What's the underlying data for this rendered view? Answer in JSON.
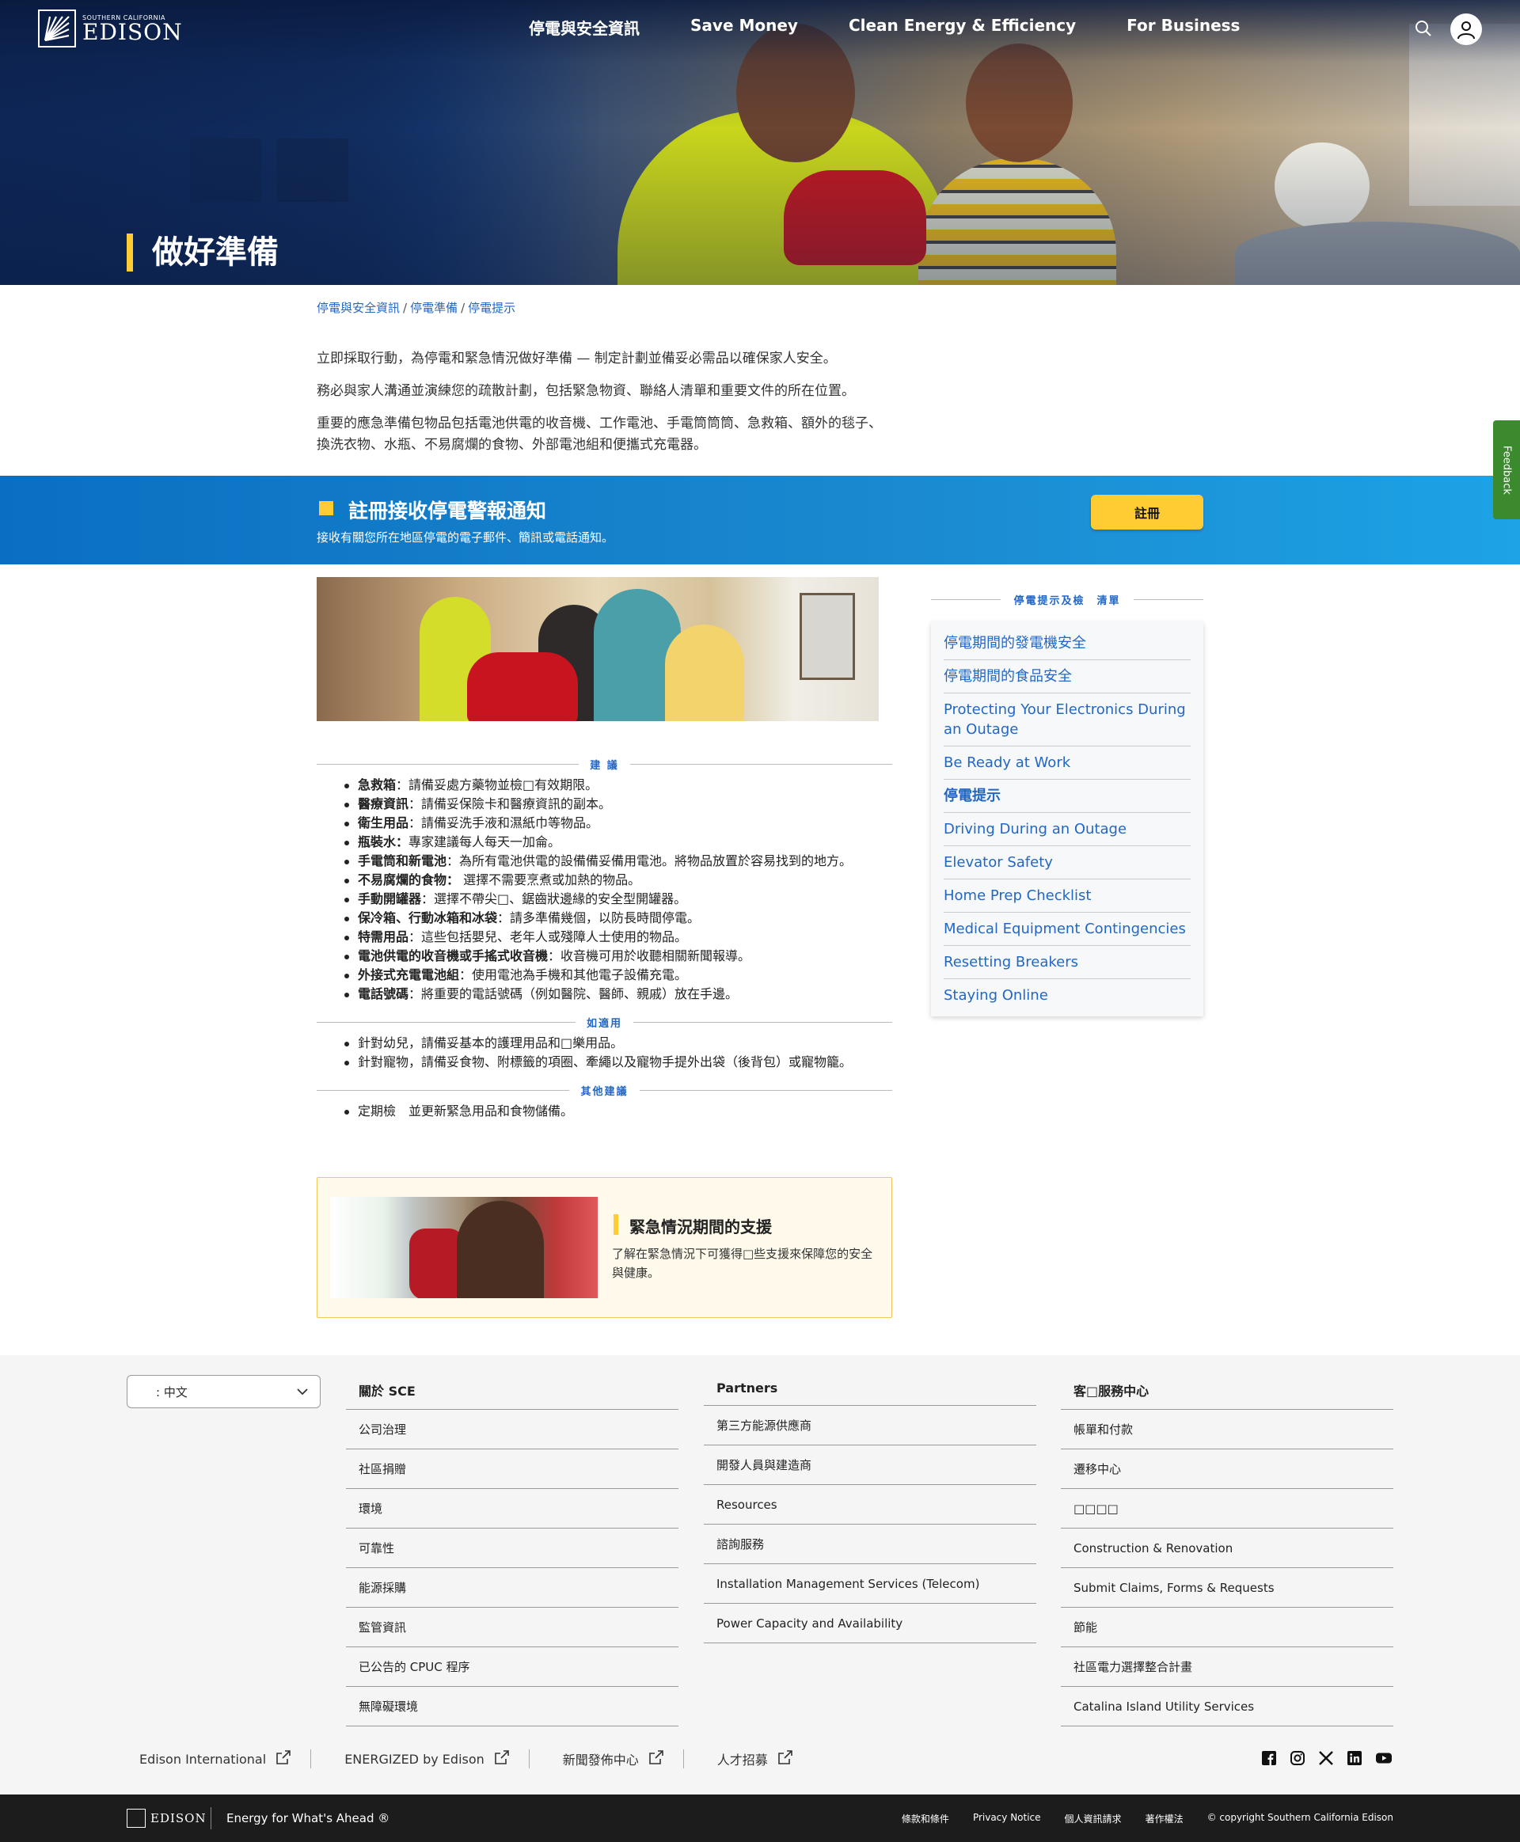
{
  "brand": {
    "small": "SOUTHERN CALIFORNIA",
    "big": "EDISON"
  },
  "nav": [
    "停電與安全資訊",
    "Save Money",
    "Clean Energy & Efficiency",
    "For Business"
  ],
  "hero": {
    "title": "做好準備"
  },
  "breadcrumb": [
    "停電與安全資訊",
    "停電準備",
    "停電提示"
  ],
  "intro": [
    "立即採取行動，為停電和緊急情況做好準備 — 制定計劃並備妥必需品以確保家人安全。",
    "務必與家人溝通並演練您的疏散計劃，包括緊急物資、聯絡人清單和重要文件的所在位置。",
    "重要的應急準備包物品包括電池供電的收音機、工作電池、手電筒筒筒、急救箱、額外的毯子、換洗衣物、水瓶、不易腐爛的食物、外部電池組和便攜式充電器。"
  ],
  "alert": {
    "title": "註冊接收停電警報通知",
    "desc": "接收有關您所在地區停電的電子郵件、簡訊或電話通知。",
    "button": "註冊"
  },
  "feedback": "Feedback",
  "sections": {
    "tips": {
      "heading": "建 議",
      "items": [
        {
          "b": "急救箱",
          "t": "：請備妥處方藥物並檢□有效期限。"
        },
        {
          "b": "醫療資訊",
          "t": "：請備妥保險卡和醫療資訊的副本。"
        },
        {
          "b": "衛生用品",
          "t": "：請備妥洗手液和濕紙巾等物品。"
        },
        {
          "b": "瓶裝水：",
          "t": "專家建議每人每天一加侖。"
        },
        {
          "b": "手電筒和新電池",
          "t": "：為所有電池供電的設備備妥備用電池。將物品放置於容易找到的地方。"
        },
        {
          "b": "不易腐爛的食物：",
          "t": " 選擇不需要烹煮或加熱的物品。"
        },
        {
          "b": "手動開罐器",
          "t": "：選擇不帶尖□、鋸齒狀邊緣的安全型開罐器。"
        },
        {
          "b": "保冷箱、行動冰箱和冰袋",
          "t": "：請多準備幾個，以防長時間停電。"
        },
        {
          "b": "特需用品",
          "t": "：這些包括嬰兒、老年人或殘障人士使用的物品。"
        },
        {
          "b": "電池供電的收音機或手搖式收音機",
          "t": "：收音機可用於收聽相關新聞報導。"
        },
        {
          "b": "外接式充電電池組",
          "t": "：使用電池為手機和其他電子設備充電。"
        },
        {
          "b": "電話號碼",
          "t": "：將重要的電話號碼（例如醫院、醫師、親戚）放在手邊。"
        }
      ]
    },
    "applicable": {
      "heading": "如適用",
      "items": [
        "針對幼兒，請備妥基本的護理用品和□樂用品。",
        "針對寵物，請備妥食物、附標籤的項圈、牽繩以及寵物手提外出袋（後背包）或寵物籠。"
      ]
    },
    "other": {
      "heading": "其他建議",
      "items": [
        "定期檢　並更新緊急用品和食物儲備。"
      ]
    }
  },
  "card": {
    "title": "緊急情況期間的支援",
    "desc": "了解在緊急情況下可獲得□些支援來保障您的安全與健康。"
  },
  "sidebar": {
    "heading": "停電提示及檢　清單",
    "items": [
      "停電期間的發電機安全",
      "停電期間的食品安全",
      "Protecting Your Electronics During an Outage",
      "Be Ready at Work",
      "停電提示",
      "Driving During an Outage",
      "Elevator Safety",
      "Home Prep Checklist",
      "Medical Equipment Contingencies",
      "Resetting Breakers",
      "Staying Online"
    ],
    "active_index": 4
  },
  "footer": {
    "language": ": 中文",
    "columns": [
      {
        "title": "關於 SCE",
        "links": [
          "公司治理",
          "社區捐贈",
          "環境",
          "可靠性",
          "能源採購",
          "監管資訊",
          "已公告的 CPUC 程序",
          "無障礙環境"
        ]
      },
      {
        "title": "Partners",
        "links": [
          "第三方能源供應商",
          "開發人員與建造商",
          "Resources",
          "諮詢服務",
          "Installation Management Services (Telecom)",
          "Power Capacity and Availability"
        ]
      },
      {
        "title": "客□服務中心",
        "links": [
          "帳單和付款",
          "遷移中心",
          "□□□□",
          "Construction & Renovation",
          "Submit Claims, Forms & Requests",
          "節能",
          "社區電力選擇整合計畫",
          "Catalina Island Utility Services"
        ]
      }
    ],
    "external_links": [
      "Edison International",
      "ENERGIZED by Edison",
      "新聞發佈中心",
      "人才招募"
    ],
    "social": [
      "facebook-icon",
      "instagram-icon",
      "x-icon",
      "linkedin-icon",
      "youtube-icon"
    ]
  },
  "bottom": {
    "tagline": "Energy for What's Ahead ®",
    "legal": [
      "條款和條件",
      "Privacy Notice",
      "個人資訊請求",
      "著作權法",
      "© copyright Southern California Edison"
    ]
  },
  "colors": {
    "accent": "#ffcd33",
    "link": "#2367c4",
    "banner": "#1b8ad0",
    "footer_bg": "#f5f5f5",
    "bottom_bg": "#1c1c1c",
    "feedback": "#3c8a2e"
  }
}
